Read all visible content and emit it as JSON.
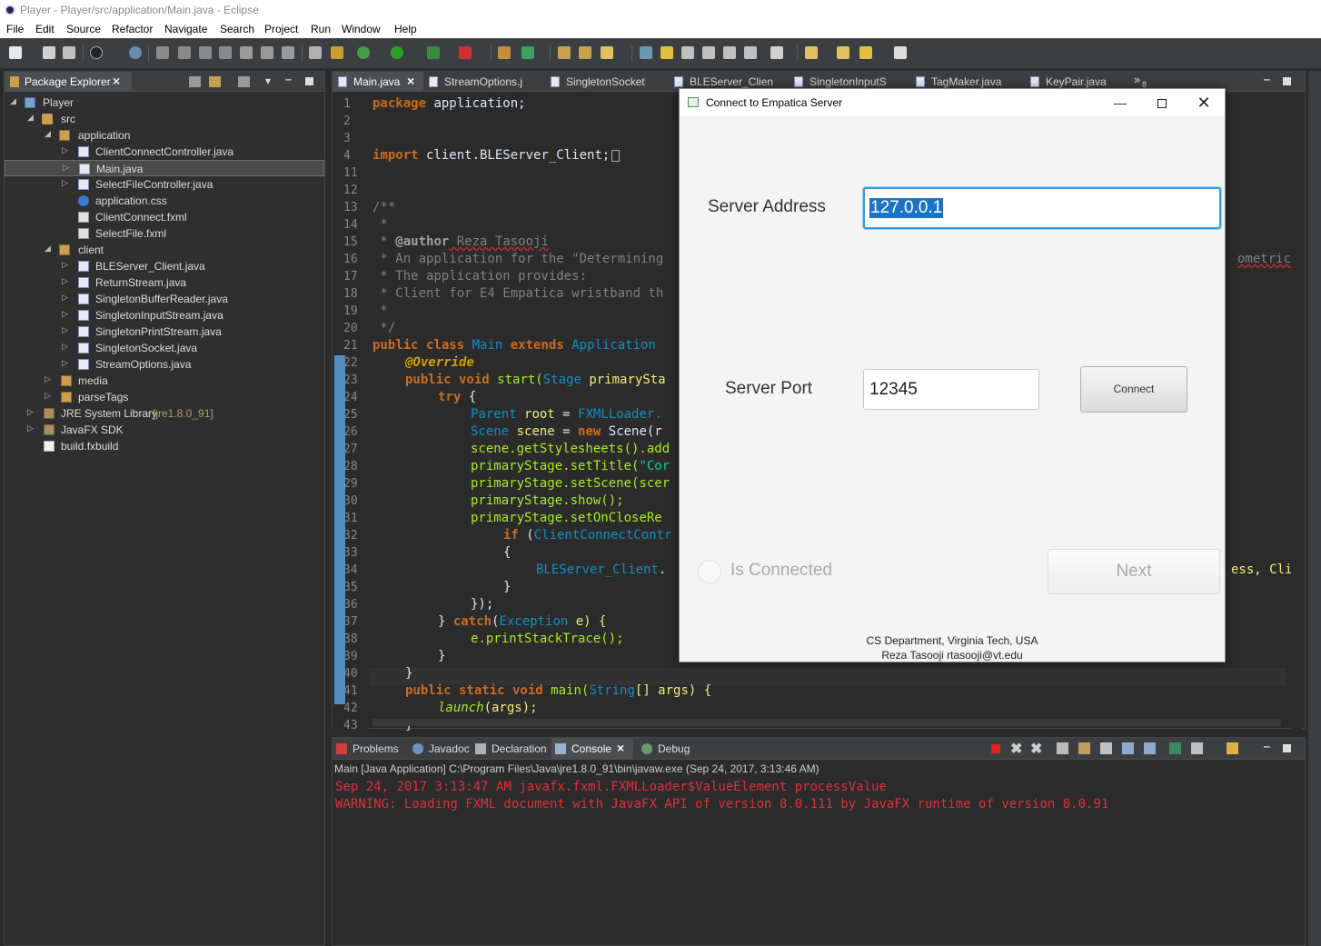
{
  "window": {
    "title": "Player - Player/src/application/Main.java - Eclipse"
  },
  "menubar": [
    "File",
    "Edit",
    "Source",
    "Refactor",
    "Navigate",
    "Search",
    "Project",
    "Run",
    "Window",
    "Help"
  ],
  "package_explorer": {
    "tab_label": "Package Explorer",
    "tree": [
      {
        "label": "Player",
        "icon": "project-icon"
      },
      {
        "label": "src",
        "icon": "source-folder-icon"
      },
      {
        "label": "application",
        "icon": "package-icon"
      },
      {
        "label": "ClientConnectController.java",
        "icon": "java-file-icon"
      },
      {
        "label": "Main.java",
        "icon": "java-file-icon"
      },
      {
        "label": "SelectFileController.java",
        "icon": "java-file-icon"
      },
      {
        "label": "application.css",
        "icon": "css-file-icon"
      },
      {
        "label": "ClientConnect.fxml",
        "icon": "fxml-file-icon"
      },
      {
        "label": "SelectFile.fxml",
        "icon": "fxml-file-icon"
      },
      {
        "label": "client",
        "icon": "package-icon"
      },
      {
        "label": "BLEServer_Client.java",
        "icon": "java-file-icon"
      },
      {
        "label": "ReturnStream.java",
        "icon": "java-file-icon"
      },
      {
        "label": "SingletonBufferReader.java",
        "icon": "java-file-icon"
      },
      {
        "label": "SingletonInputStream.java",
        "icon": "java-file-icon"
      },
      {
        "label": "SingletonPrintStream.java",
        "icon": "java-file-icon"
      },
      {
        "label": "SingletonSocket.java",
        "icon": "java-file-icon"
      },
      {
        "label": "StreamOptions.java",
        "icon": "java-file-icon"
      },
      {
        "label": "media",
        "icon": "package-icon"
      },
      {
        "label": "parseTags",
        "icon": "package-icon"
      },
      {
        "label": "JRE System Library",
        "decoration": "[jre1.8.0_91]",
        "icon": "library-icon"
      },
      {
        "label": "JavaFX SDK",
        "icon": "library-icon"
      },
      {
        "label": "build.fxbuild",
        "icon": "fxbuild-file-icon"
      }
    ]
  },
  "editor": {
    "tabs": [
      "Main.java",
      "StreamOptions.j",
      "SingletonSocket",
      "BLEServer_Clien",
      "SingletonInputS",
      "TagMaker.java",
      "KeyPair.java"
    ],
    "overflow_count": "8",
    "line_numbers": [
      "1",
      "2",
      "3",
      "4",
      "11",
      "12",
      "13",
      "14",
      "15",
      "16",
      "17",
      "18",
      "19",
      "20",
      "21",
      "22",
      "23",
      "24",
      "25",
      "26",
      "27",
      "28",
      "29",
      "30",
      "31",
      "32",
      "33",
      "34",
      "35",
      "36",
      "37",
      "38",
      "39",
      "40",
      "41",
      "42",
      "43"
    ],
    "code": {
      "l1a": "package",
      "l1b": " application;",
      "l4a": "import",
      "l4b": " client.BLEServer_Client;",
      "l13": "/**",
      "l14": " *",
      "l15a": " * ",
      "l15b": "@author",
      "l15c": " Reza Tasooji",
      "l16": " * An application for the \"Determining",
      "l16r": "ometric",
      "l17": " * The application provides:",
      "l18": " * Client for E4 Empatica wristband th",
      "l19": " *",
      "l20": " */",
      "l21a": "public class",
      "l21b": "Main",
      "l21c": "extends",
      "l21d": "Application",
      "l22": "@Override",
      "l23a": "public void",
      "l23b": "start(",
      "l23c": "Stage",
      "l23d": " primarySta",
      "l24": "try",
      "l25a": "Parent",
      "l25b": "root",
      "l25c": " = ",
      "l25d": "FXMLLoader.",
      "l26a": "Scene",
      "l26b": "scene",
      "l26c": " = ",
      "l26d": "new",
      "l26e": " Scene(r",
      "l27": "scene.getStylesheets().add",
      "l28a": "primaryStage",
      "l28b": ".setTitle(",
      "l28c": "\"Cor",
      "l29a": "primaryStage",
      "l29b": ".setScene(scer",
      "l30a": "primaryStage",
      "l30b": ".show();",
      "l31a": "primaryStage",
      "l31b": ".setOnCloseRe",
      "l32a": "if",
      "l32b": " (",
      "l32c": "ClientConnectContr",
      "l33": "{",
      "l34a": "BLEServer_Client",
      "l34b": ".",
      "l34r": "ess, Cli",
      "l35": "}",
      "l36": "});",
      "l37a": "} ",
      "l37b": "catch",
      "l37c": "(",
      "l37d": "Exception",
      "l37e": " e) {",
      "l38": "e.printStackTrace();",
      "l39": "}",
      "l40": "}",
      "l41a": "public static void",
      "l41b": "main(",
      "l41c": "String",
      "l41d": "[] args) {",
      "l42a": "launch",
      "l42b": "(args);",
      "l43": "}"
    }
  },
  "console": {
    "tabs": [
      "Problems",
      "Javadoc",
      "Declaration",
      "Console",
      "Debug"
    ],
    "description": "Main [Java Application] C:\\Program Files\\Java\\jre1.8.0_91\\bin\\javaw.exe (Sep 24, 2017, 3:13:46 AM)",
    "lines": [
      "Sep 24, 2017 3:13:47 AM javafx.fxml.FXMLLoader$ValueElement processValue",
      "WARNING: Loading FXML document with JavaFX API of version 8.0.111 by JavaFX runtime of version 8.0.91"
    ]
  },
  "dialog": {
    "title": "Connect to Empatica Server",
    "server_address_label": "Server Address",
    "server_address_value": "127.0.0.1",
    "server_port_label": "Server Port",
    "server_port_value": "12345",
    "connect_button": "Connect",
    "is_connected_label": "Is Connected",
    "next_button": "Next",
    "footer_line1": "CS Department, Virginia Tech, USA",
    "footer_line2": "Reza Tasooji rtasooji@vt.edu"
  },
  "colors": {
    "console_error": "#e0303a",
    "selection": "#1b73c5",
    "focus_ring": "#3a98d8"
  }
}
